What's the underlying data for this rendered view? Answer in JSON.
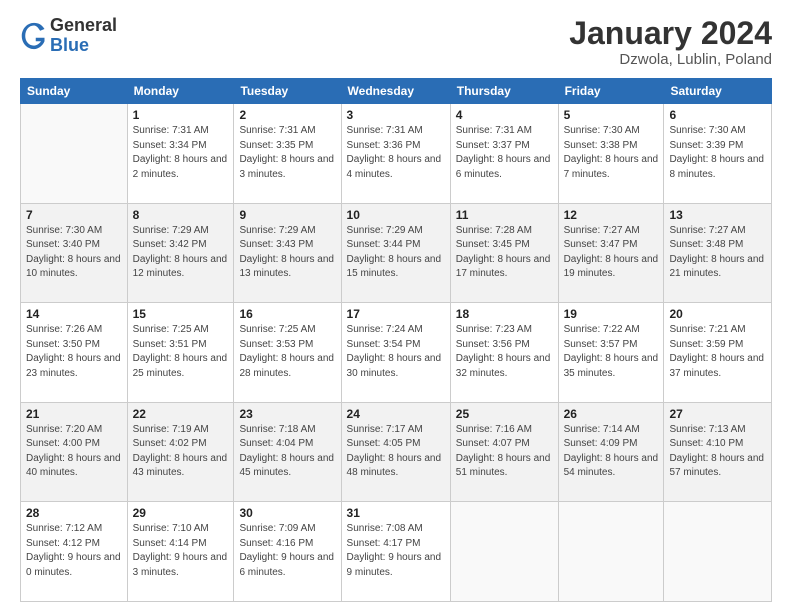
{
  "header": {
    "logo_general": "General",
    "logo_blue": "Blue",
    "month_year": "January 2024",
    "location": "Dzwola, Lublin, Poland"
  },
  "weekdays": [
    "Sunday",
    "Monday",
    "Tuesday",
    "Wednesday",
    "Thursday",
    "Friday",
    "Saturday"
  ],
  "weeks": [
    [
      {
        "day": "",
        "sunrise": "",
        "sunset": "",
        "daylight": ""
      },
      {
        "day": "1",
        "sunrise": "Sunrise: 7:31 AM",
        "sunset": "Sunset: 3:34 PM",
        "daylight": "Daylight: 8 hours and 2 minutes."
      },
      {
        "day": "2",
        "sunrise": "Sunrise: 7:31 AM",
        "sunset": "Sunset: 3:35 PM",
        "daylight": "Daylight: 8 hours and 3 minutes."
      },
      {
        "day": "3",
        "sunrise": "Sunrise: 7:31 AM",
        "sunset": "Sunset: 3:36 PM",
        "daylight": "Daylight: 8 hours and 4 minutes."
      },
      {
        "day": "4",
        "sunrise": "Sunrise: 7:31 AM",
        "sunset": "Sunset: 3:37 PM",
        "daylight": "Daylight: 8 hours and 6 minutes."
      },
      {
        "day": "5",
        "sunrise": "Sunrise: 7:30 AM",
        "sunset": "Sunset: 3:38 PM",
        "daylight": "Daylight: 8 hours and 7 minutes."
      },
      {
        "day": "6",
        "sunrise": "Sunrise: 7:30 AM",
        "sunset": "Sunset: 3:39 PM",
        "daylight": "Daylight: 8 hours and 8 minutes."
      }
    ],
    [
      {
        "day": "7",
        "sunrise": "Sunrise: 7:30 AM",
        "sunset": "Sunset: 3:40 PM",
        "daylight": "Daylight: 8 hours and 10 minutes."
      },
      {
        "day": "8",
        "sunrise": "Sunrise: 7:29 AM",
        "sunset": "Sunset: 3:42 PM",
        "daylight": "Daylight: 8 hours and 12 minutes."
      },
      {
        "day": "9",
        "sunrise": "Sunrise: 7:29 AM",
        "sunset": "Sunset: 3:43 PM",
        "daylight": "Daylight: 8 hours and 13 minutes."
      },
      {
        "day": "10",
        "sunrise": "Sunrise: 7:29 AM",
        "sunset": "Sunset: 3:44 PM",
        "daylight": "Daylight: 8 hours and 15 minutes."
      },
      {
        "day": "11",
        "sunrise": "Sunrise: 7:28 AM",
        "sunset": "Sunset: 3:45 PM",
        "daylight": "Daylight: 8 hours and 17 minutes."
      },
      {
        "day": "12",
        "sunrise": "Sunrise: 7:27 AM",
        "sunset": "Sunset: 3:47 PM",
        "daylight": "Daylight: 8 hours and 19 minutes."
      },
      {
        "day": "13",
        "sunrise": "Sunrise: 7:27 AM",
        "sunset": "Sunset: 3:48 PM",
        "daylight": "Daylight: 8 hours and 21 minutes."
      }
    ],
    [
      {
        "day": "14",
        "sunrise": "Sunrise: 7:26 AM",
        "sunset": "Sunset: 3:50 PM",
        "daylight": "Daylight: 8 hours and 23 minutes."
      },
      {
        "day": "15",
        "sunrise": "Sunrise: 7:25 AM",
        "sunset": "Sunset: 3:51 PM",
        "daylight": "Daylight: 8 hours and 25 minutes."
      },
      {
        "day": "16",
        "sunrise": "Sunrise: 7:25 AM",
        "sunset": "Sunset: 3:53 PM",
        "daylight": "Daylight: 8 hours and 28 minutes."
      },
      {
        "day": "17",
        "sunrise": "Sunrise: 7:24 AM",
        "sunset": "Sunset: 3:54 PM",
        "daylight": "Daylight: 8 hours and 30 minutes."
      },
      {
        "day": "18",
        "sunrise": "Sunrise: 7:23 AM",
        "sunset": "Sunset: 3:56 PM",
        "daylight": "Daylight: 8 hours and 32 minutes."
      },
      {
        "day": "19",
        "sunrise": "Sunrise: 7:22 AM",
        "sunset": "Sunset: 3:57 PM",
        "daylight": "Daylight: 8 hours and 35 minutes."
      },
      {
        "day": "20",
        "sunrise": "Sunrise: 7:21 AM",
        "sunset": "Sunset: 3:59 PM",
        "daylight": "Daylight: 8 hours and 37 minutes."
      }
    ],
    [
      {
        "day": "21",
        "sunrise": "Sunrise: 7:20 AM",
        "sunset": "Sunset: 4:00 PM",
        "daylight": "Daylight: 8 hours and 40 minutes."
      },
      {
        "day": "22",
        "sunrise": "Sunrise: 7:19 AM",
        "sunset": "Sunset: 4:02 PM",
        "daylight": "Daylight: 8 hours and 43 minutes."
      },
      {
        "day": "23",
        "sunrise": "Sunrise: 7:18 AM",
        "sunset": "Sunset: 4:04 PM",
        "daylight": "Daylight: 8 hours and 45 minutes."
      },
      {
        "day": "24",
        "sunrise": "Sunrise: 7:17 AM",
        "sunset": "Sunset: 4:05 PM",
        "daylight": "Daylight: 8 hours and 48 minutes."
      },
      {
        "day": "25",
        "sunrise": "Sunrise: 7:16 AM",
        "sunset": "Sunset: 4:07 PM",
        "daylight": "Daylight: 8 hours and 51 minutes."
      },
      {
        "day": "26",
        "sunrise": "Sunrise: 7:14 AM",
        "sunset": "Sunset: 4:09 PM",
        "daylight": "Daylight: 8 hours and 54 minutes."
      },
      {
        "day": "27",
        "sunrise": "Sunrise: 7:13 AM",
        "sunset": "Sunset: 4:10 PM",
        "daylight": "Daylight: 8 hours and 57 minutes."
      }
    ],
    [
      {
        "day": "28",
        "sunrise": "Sunrise: 7:12 AM",
        "sunset": "Sunset: 4:12 PM",
        "daylight": "Daylight: 9 hours and 0 minutes."
      },
      {
        "day": "29",
        "sunrise": "Sunrise: 7:10 AM",
        "sunset": "Sunset: 4:14 PM",
        "daylight": "Daylight: 9 hours and 3 minutes."
      },
      {
        "day": "30",
        "sunrise": "Sunrise: 7:09 AM",
        "sunset": "Sunset: 4:16 PM",
        "daylight": "Daylight: 9 hours and 6 minutes."
      },
      {
        "day": "31",
        "sunrise": "Sunrise: 7:08 AM",
        "sunset": "Sunset: 4:17 PM",
        "daylight": "Daylight: 9 hours and 9 minutes."
      },
      {
        "day": "",
        "sunrise": "",
        "sunset": "",
        "daylight": ""
      },
      {
        "day": "",
        "sunrise": "",
        "sunset": "",
        "daylight": ""
      },
      {
        "day": "",
        "sunrise": "",
        "sunset": "",
        "daylight": ""
      }
    ]
  ]
}
